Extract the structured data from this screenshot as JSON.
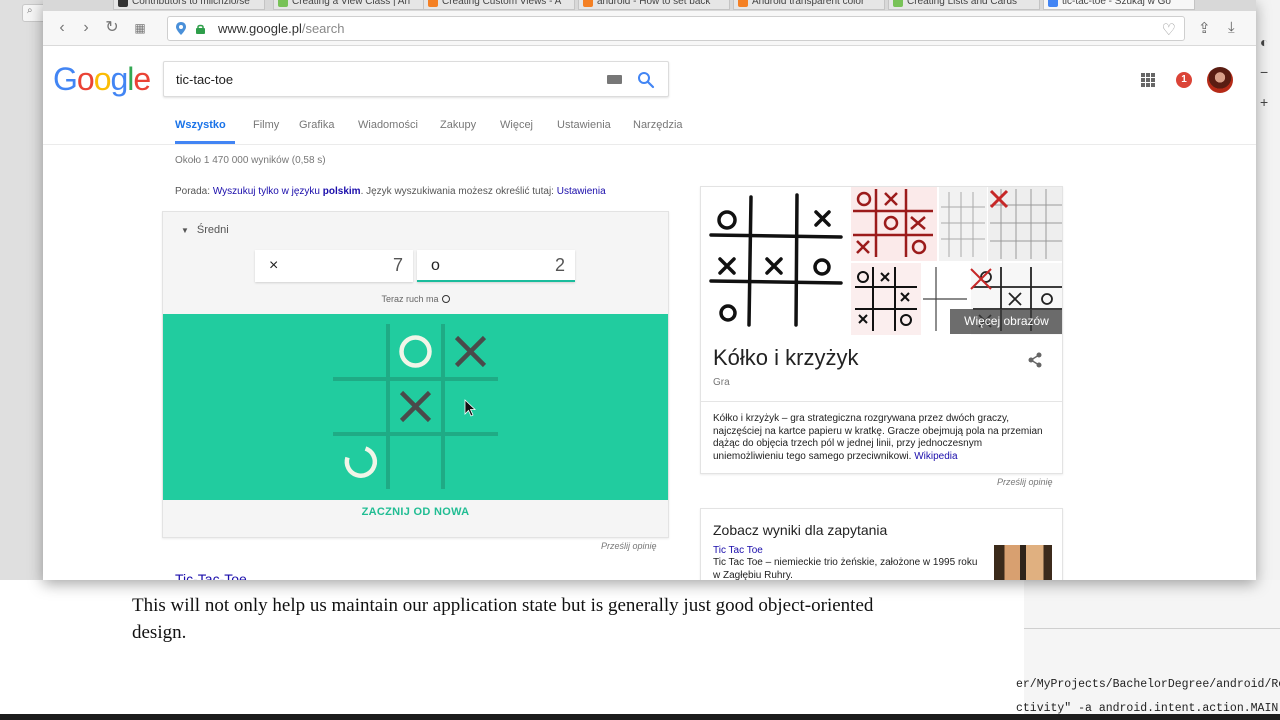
{
  "browser": {
    "tabs": [
      {
        "label": "Contributors to mlichzio/se",
        "color": "#333333"
      },
      {
        "label": "Creating a View Class | An",
        "color": "#78c257"
      },
      {
        "label": "Creating Custom Views - A",
        "color": "#f48024"
      },
      {
        "label": "android - How to set back",
        "color": "#f48024"
      },
      {
        "label": "Android transparent color",
        "color": "#f48024"
      },
      {
        "label": "Creating Lists and Cards",
        "color": "#78c257"
      },
      {
        "label": "tic-tac-toe - Szukaj w Go",
        "color": "#4285f4"
      }
    ],
    "url_host": "www.google.pl",
    "url_path": "/search"
  },
  "google": {
    "logo_letters": [
      {
        "ch": "G",
        "color": "#4285f4"
      },
      {
        "ch": "o",
        "color": "#ea4335"
      },
      {
        "ch": "o",
        "color": "#fbbc05"
      },
      {
        "ch": "g",
        "color": "#4285f4"
      },
      {
        "ch": "l",
        "color": "#34a853"
      },
      {
        "ch": "e",
        "color": "#ea4335"
      }
    ],
    "query": "tic-tac-toe",
    "notifications": "1",
    "nav_tabs": [
      "Wszystko",
      "Filmy",
      "Grafika",
      "Wiadomości",
      "Zakupy",
      "Więcej",
      "Ustawienia",
      "Narzędzia"
    ],
    "active_tab": "Wszystko"
  },
  "results": {
    "stats": "Około 1 470 000 wyników (0,58 s)",
    "tip_prefix": "Porada: ",
    "tip_link": "Wyszukuj tylko w języku",
    "tip_bold": "polskim",
    "tip_middle": ". Język wyszukiwania możesz określić tutaj: ",
    "tip_settings": "Ustawienia",
    "first_result": "Tic-Tac-Toe"
  },
  "game": {
    "difficulty": "Średni",
    "score_x_symbol": "×",
    "score_x": "7",
    "score_o_symbol": "o",
    "score_o": "2",
    "turn_label": "Teraz ruch ma",
    "board": [
      [
        "",
        "O",
        "X"
      ],
      [
        "",
        "X",
        ""
      ],
      [
        "O",
        "",
        ""
      ]
    ],
    "board_color": "#21cc9f",
    "restart_label": "ZACZNIJ OD NOWA",
    "feedback": "Prześlij opinię"
  },
  "knowledge_panel": {
    "more_images": "Więcej obrazów",
    "title": "Kółko i krzyżyk",
    "subtitle": "Gra",
    "description": "Kółko i krzyżyk – gra strategiczna rozgrywana przez dwóch graczy, najczęściej na kartce papieru w kratkę. Gracze obejmują pola na przemian dążąc do objęcia trzech pól w jednej linii, przy jednoczesnym uniemożliwieniu tego samego przeciwnikowi.",
    "source_link": "Wikipedia",
    "feedback": "Prześlij opinię"
  },
  "see_results": {
    "title": "Zobacz wyniki dla zapytania",
    "link": "Tic Tac Toe",
    "description": "Tic Tac Toe – niemieckie trio żeńskie, założone w 1995 roku w Zagłębiu Ruhry."
  },
  "document": {
    "text": "This will not only help us maintain our application state but is generally just good object-oriented design."
  },
  "terminal": {
    "line1": "er/MyProjects/BachelorDegree/android/Remot",
    "line2": "ctivity\" -a android.intent.action.MAIN -c a"
  }
}
